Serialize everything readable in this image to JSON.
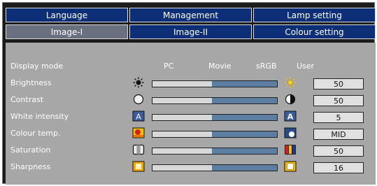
{
  "tabs_row1": [
    "Language",
    "Management",
    "Lamp setting"
  ],
  "tabs_row2": [
    "Image-I",
    "Image-II",
    "Colour setting"
  ],
  "active_tab": "Image-I",
  "display_mode": {
    "label": "Display mode",
    "options": [
      "PC",
      "Movie",
      "sRGB",
      "User"
    ]
  },
  "settings": [
    {
      "label": "Brightness",
      "value": "50",
      "level": 0.48
    },
    {
      "label": "Contrast",
      "value": "50",
      "level": 0.48
    },
    {
      "label": "White intensity",
      "value": "5",
      "level": 0.48
    },
    {
      "label": "Colour temp.",
      "value": "MID",
      "level": 0.48
    },
    {
      "label": "Saturation",
      "value": "50",
      "level": 0.48
    },
    {
      "label": "Sharpness",
      "value": "16",
      "level": 0.48
    }
  ],
  "colors": {
    "tab_bg": "#0c2f78",
    "tab_active_bg": "#6b7080",
    "panel_bg": "#a7a7a7",
    "slider_track": "#5d7ea0",
    "slider_fill": "#d9d9d9"
  }
}
